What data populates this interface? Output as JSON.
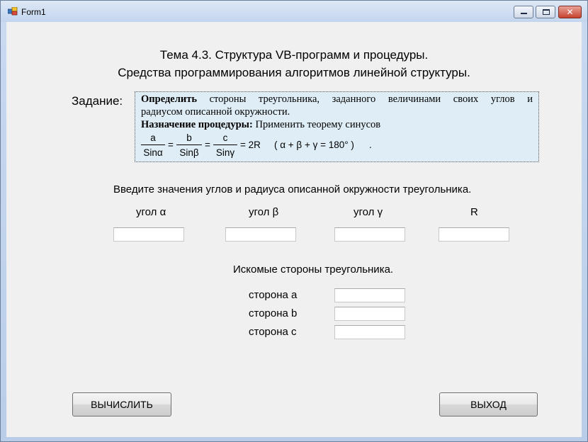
{
  "window": {
    "title": "Form1"
  },
  "heading": {
    "line1": "Тема 4.3. Структура VB-программ и процедуры.",
    "line2": "Средства программирования алгоритмов линейной структуры."
  },
  "task": {
    "label": "Задание:",
    "define_bold": "Определить",
    "define_words": [
      "стороны",
      "треугольника,",
      "заданного",
      "величинами",
      "своих",
      "углов",
      "и"
    ],
    "define_line2": "радиусом описанной окружности.",
    "purpose_bold": "Назначение процедуры:",
    "purpose_text": " Применить теорему синусов",
    "formula": {
      "a_num": "a",
      "a_den": "Sinα",
      "b_num": "b",
      "b_den": "Sinβ",
      "c_num": "c",
      "c_den": "Sinγ",
      "eq1": "=",
      "eq2": "=",
      "eq3": "= 2R",
      "angles": "( α + β + γ = 180° )",
      "dot": "."
    }
  },
  "inputs": {
    "prompt": "Введите значения углов и радиуса описанной окружности треугольника.",
    "alpha_label": "угол α",
    "beta_label": "угол β",
    "gamma_label": "угол γ",
    "r_label": "R",
    "alpha_value": "",
    "beta_value": "",
    "gamma_value": "",
    "r_value": ""
  },
  "outputs": {
    "title": "Искомые стороны треугольника.",
    "side_a_label": "сторона a",
    "side_b_label": "сторона b",
    "side_c_label": "сторона c",
    "side_a_value": "",
    "side_b_value": "",
    "side_c_value": ""
  },
  "buttons": {
    "calculate": "ВЫЧИСЛИТЬ",
    "exit": "ВЫХОД"
  },
  "colors": {
    "task_bg": "#dfeef6",
    "form_bg": "#f0f0f0",
    "close_btn": "#c5432f"
  }
}
